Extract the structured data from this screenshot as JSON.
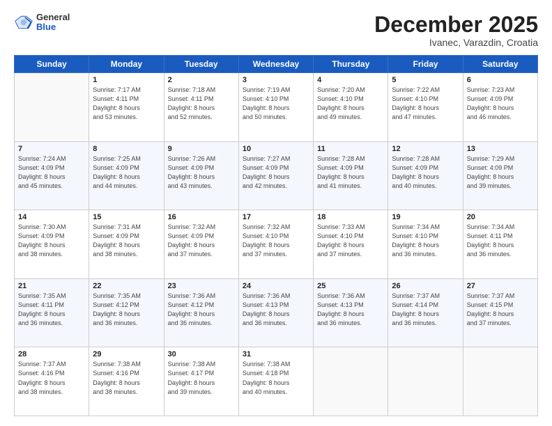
{
  "header": {
    "logo_general": "General",
    "logo_blue": "Blue",
    "title": "December 2025",
    "subtitle": "Ivanec, Varazdin, Croatia"
  },
  "days_of_week": [
    "Sunday",
    "Monday",
    "Tuesday",
    "Wednesday",
    "Thursday",
    "Friday",
    "Saturday"
  ],
  "weeks": [
    [
      {
        "day": "",
        "info": ""
      },
      {
        "day": "1",
        "info": "Sunrise: 7:17 AM\nSunset: 4:11 PM\nDaylight: 8 hours\nand 53 minutes."
      },
      {
        "day": "2",
        "info": "Sunrise: 7:18 AM\nSunset: 4:11 PM\nDaylight: 8 hours\nand 52 minutes."
      },
      {
        "day": "3",
        "info": "Sunrise: 7:19 AM\nSunset: 4:10 PM\nDaylight: 8 hours\nand 50 minutes."
      },
      {
        "day": "4",
        "info": "Sunrise: 7:20 AM\nSunset: 4:10 PM\nDaylight: 8 hours\nand 49 minutes."
      },
      {
        "day": "5",
        "info": "Sunrise: 7:22 AM\nSunset: 4:10 PM\nDaylight: 8 hours\nand 47 minutes."
      },
      {
        "day": "6",
        "info": "Sunrise: 7:23 AM\nSunset: 4:09 PM\nDaylight: 8 hours\nand 46 minutes."
      }
    ],
    [
      {
        "day": "7",
        "info": "Sunrise: 7:24 AM\nSunset: 4:09 PM\nDaylight: 8 hours\nand 45 minutes."
      },
      {
        "day": "8",
        "info": "Sunrise: 7:25 AM\nSunset: 4:09 PM\nDaylight: 8 hours\nand 44 minutes."
      },
      {
        "day": "9",
        "info": "Sunrise: 7:26 AM\nSunset: 4:09 PM\nDaylight: 8 hours\nand 43 minutes."
      },
      {
        "day": "10",
        "info": "Sunrise: 7:27 AM\nSunset: 4:09 PM\nDaylight: 8 hours\nand 42 minutes."
      },
      {
        "day": "11",
        "info": "Sunrise: 7:28 AM\nSunset: 4:09 PM\nDaylight: 8 hours\nand 41 minutes."
      },
      {
        "day": "12",
        "info": "Sunrise: 7:28 AM\nSunset: 4:09 PM\nDaylight: 8 hours\nand 40 minutes."
      },
      {
        "day": "13",
        "info": "Sunrise: 7:29 AM\nSunset: 4:09 PM\nDaylight: 8 hours\nand 39 minutes."
      }
    ],
    [
      {
        "day": "14",
        "info": "Sunrise: 7:30 AM\nSunset: 4:09 PM\nDaylight: 8 hours\nand 38 minutes."
      },
      {
        "day": "15",
        "info": "Sunrise: 7:31 AM\nSunset: 4:09 PM\nDaylight: 8 hours\nand 38 minutes."
      },
      {
        "day": "16",
        "info": "Sunrise: 7:32 AM\nSunset: 4:09 PM\nDaylight: 8 hours\nand 37 minutes."
      },
      {
        "day": "17",
        "info": "Sunrise: 7:32 AM\nSunset: 4:10 PM\nDaylight: 8 hours\nand 37 minutes."
      },
      {
        "day": "18",
        "info": "Sunrise: 7:33 AM\nSunset: 4:10 PM\nDaylight: 8 hours\nand 37 minutes."
      },
      {
        "day": "19",
        "info": "Sunrise: 7:34 AM\nSunset: 4:10 PM\nDaylight: 8 hours\nand 36 minutes."
      },
      {
        "day": "20",
        "info": "Sunrise: 7:34 AM\nSunset: 4:11 PM\nDaylight: 8 hours\nand 36 minutes."
      }
    ],
    [
      {
        "day": "21",
        "info": "Sunrise: 7:35 AM\nSunset: 4:11 PM\nDaylight: 8 hours\nand 36 minutes."
      },
      {
        "day": "22",
        "info": "Sunrise: 7:35 AM\nSunset: 4:12 PM\nDaylight: 8 hours\nand 36 minutes."
      },
      {
        "day": "23",
        "info": "Sunrise: 7:36 AM\nSunset: 4:12 PM\nDaylight: 8 hours\nand 36 minutes."
      },
      {
        "day": "24",
        "info": "Sunrise: 7:36 AM\nSunset: 4:13 PM\nDaylight: 8 hours\nand 36 minutes."
      },
      {
        "day": "25",
        "info": "Sunrise: 7:36 AM\nSunset: 4:13 PM\nDaylight: 8 hours\nand 36 minutes."
      },
      {
        "day": "26",
        "info": "Sunrise: 7:37 AM\nSunset: 4:14 PM\nDaylight: 8 hours\nand 36 minutes."
      },
      {
        "day": "27",
        "info": "Sunrise: 7:37 AM\nSunset: 4:15 PM\nDaylight: 8 hours\nand 37 minutes."
      }
    ],
    [
      {
        "day": "28",
        "info": "Sunrise: 7:37 AM\nSunset: 4:16 PM\nDaylight: 8 hours\nand 38 minutes."
      },
      {
        "day": "29",
        "info": "Sunrise: 7:38 AM\nSunset: 4:16 PM\nDaylight: 8 hours\nand 38 minutes."
      },
      {
        "day": "30",
        "info": "Sunrise: 7:38 AM\nSunset: 4:17 PM\nDaylight: 8 hours\nand 39 minutes."
      },
      {
        "day": "31",
        "info": "Sunrise: 7:38 AM\nSunset: 4:18 PM\nDaylight: 8 hours\nand 40 minutes."
      },
      {
        "day": "",
        "info": ""
      },
      {
        "day": "",
        "info": ""
      },
      {
        "day": "",
        "info": ""
      }
    ]
  ]
}
